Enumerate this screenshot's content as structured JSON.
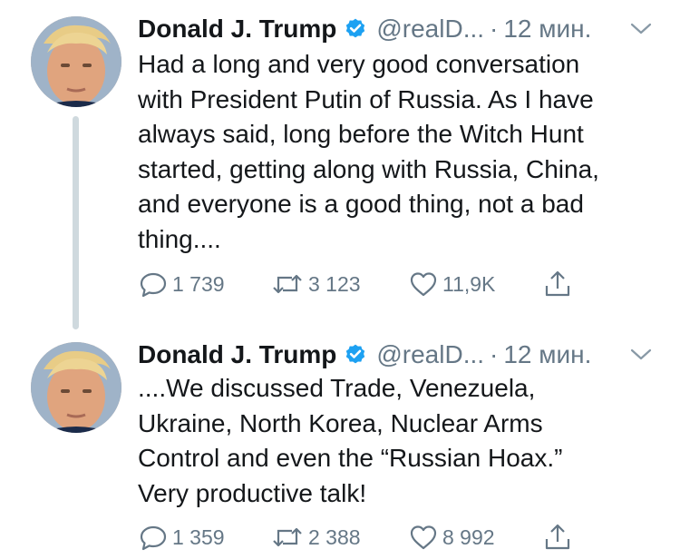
{
  "tweets": [
    {
      "author": {
        "name": "Donald J. Trump",
        "handle": "@realD...",
        "verified": true,
        "avatar": "profile-photo"
      },
      "time": "12 мин.",
      "separator": "·",
      "text": "Had a long and very good conversation\nwith President Putin of Russia. As I have\nalways said, long before the Witch Hunt\nstarted, getting along with Russia, China,\nand everyone is a good thing, not a bad\nthing....",
      "actions": {
        "replies": "1 739",
        "retweets": "3 123",
        "likes": "11,9K"
      }
    },
    {
      "author": {
        "name": "Donald J. Trump",
        "handle": "@realD...",
        "verified": true,
        "avatar": "profile-photo"
      },
      "time": "12 мин.",
      "separator": "·",
      "text": "....We discussed Trade, Venezuela,\nUkraine, North Korea, Nuclear Arms\nControl and even the “Russian Hoax.”\nVery productive talk!",
      "actions": {
        "replies": "1 359",
        "retweets": "2 388",
        "likes": "8 992"
      }
    }
  ],
  "icons": {
    "verified": "verified-badge-icon",
    "caret": "chevron-down-icon",
    "reply": "reply-icon",
    "retweet": "retweet-icon",
    "like": "heart-icon",
    "share": "share-icon"
  },
  "colors": {
    "verified": "#1da1f2",
    "secondary_text": "#657786",
    "thread_line": "#cfd9de"
  }
}
